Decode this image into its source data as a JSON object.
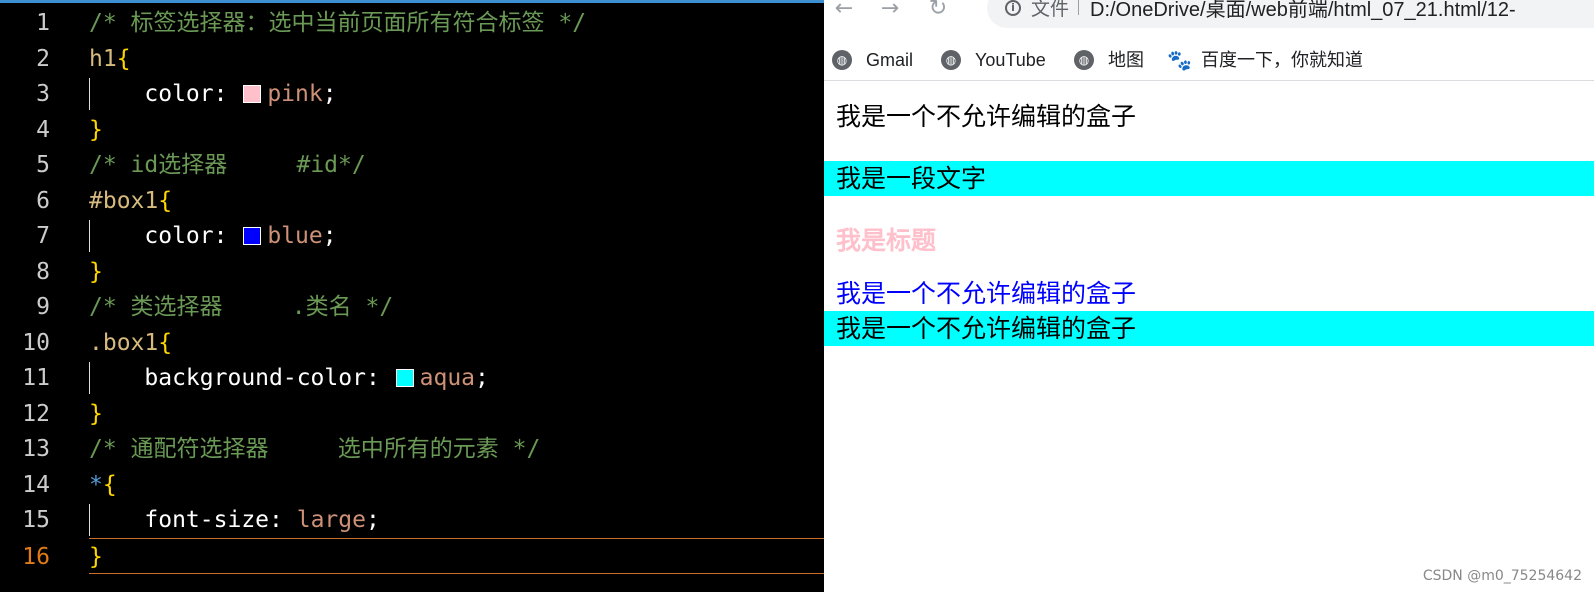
{
  "editor": {
    "lines": [
      {
        "num": "1",
        "parts": [
          {
            "cls": "cmt",
            "text": "/* 标签选择器：选中当前页面所有符合标签 */"
          }
        ]
      },
      {
        "num": "2",
        "parts": [
          {
            "cls": "sel",
            "text": "h1"
          },
          {
            "cls": "brace",
            "text": "{"
          }
        ]
      },
      {
        "num": "3",
        "guide": true,
        "parts": [
          {
            "cls": "prop",
            "text": "    color: "
          },
          {
            "swatch": "#ffc0cb"
          },
          {
            "cls": "val",
            "text": "pink"
          },
          {
            "cls": "punc",
            "text": ";"
          }
        ]
      },
      {
        "num": "4",
        "parts": [
          {
            "cls": "brace",
            "text": "}"
          }
        ]
      },
      {
        "num": "5",
        "parts": [
          {
            "cls": "cmt",
            "text": "/* id选择器     #id*/"
          }
        ]
      },
      {
        "num": "6",
        "parts": [
          {
            "cls": "sel",
            "text": "#box1"
          },
          {
            "cls": "brace",
            "text": "{"
          }
        ]
      },
      {
        "num": "7",
        "guide": true,
        "parts": [
          {
            "cls": "prop",
            "text": "    color: "
          },
          {
            "swatch": "#0000ff"
          },
          {
            "cls": "val",
            "text": "blue"
          },
          {
            "cls": "punc",
            "text": ";"
          }
        ]
      },
      {
        "num": "8",
        "parts": [
          {
            "cls": "brace",
            "text": "}"
          }
        ]
      },
      {
        "num": "9",
        "parts": [
          {
            "cls": "cmt",
            "text": "/* 类选择器     .类名 */"
          }
        ]
      },
      {
        "num": "10",
        "parts": [
          {
            "cls": "sel",
            "text": ".box1"
          },
          {
            "cls": "brace",
            "text": "{"
          }
        ]
      },
      {
        "num": "11",
        "guide": true,
        "parts": [
          {
            "cls": "prop",
            "text": "    background-color: "
          },
          {
            "swatch": "#00ffff"
          },
          {
            "cls": "val",
            "text": "aqua"
          },
          {
            "cls": "punc",
            "text": ";"
          }
        ]
      },
      {
        "num": "12",
        "parts": [
          {
            "cls": "brace",
            "text": "}"
          }
        ]
      },
      {
        "num": "13",
        "parts": [
          {
            "cls": "cmt",
            "text": "/* 通配符选择器     选中所有的元素 */"
          }
        ]
      },
      {
        "num": "14",
        "parts": [
          {
            "cls": "star",
            "text": "*"
          },
          {
            "cls": "brace",
            "text": "{"
          }
        ]
      },
      {
        "num": "15",
        "guide": true,
        "parts": [
          {
            "cls": "prop",
            "text": "    font-size: "
          },
          {
            "cls": "val",
            "text": "large"
          },
          {
            "cls": "punc",
            "text": ";"
          }
        ]
      },
      {
        "num": "16",
        "current": true,
        "parts": [
          {
            "cls": "brace",
            "text": "}"
          }
        ]
      }
    ]
  },
  "browser": {
    "nav": {
      "back": "←",
      "forward": "→",
      "reload": "↻"
    },
    "omnibox": {
      "label": "文件",
      "url": "D:/OneDrive/桌面/web前端/html_07_21.html/12-"
    },
    "bookmarks": [
      {
        "icon": "globe-icon",
        "label": "Gmail"
      },
      {
        "icon": "globe-icon",
        "label": "YouTube"
      },
      {
        "icon": "globe-icon",
        "label": "地图"
      },
      {
        "icon": "baidu-paw-icon",
        "label": "百度一下，你就知道"
      }
    ],
    "content": [
      {
        "text": "我是一个不允许编辑的盒子",
        "style": "plain"
      },
      {
        "text": "我是一段文字",
        "style": "aqua"
      },
      {
        "text": "我是标题",
        "style": "pink-h1"
      },
      {
        "text": "我是一个不允许编辑的盒子",
        "style": "blue"
      },
      {
        "text": "我是一个不允许编辑的盒子",
        "style": "aqua"
      }
    ]
  },
  "watermark": "CSDN @m0_75254642"
}
